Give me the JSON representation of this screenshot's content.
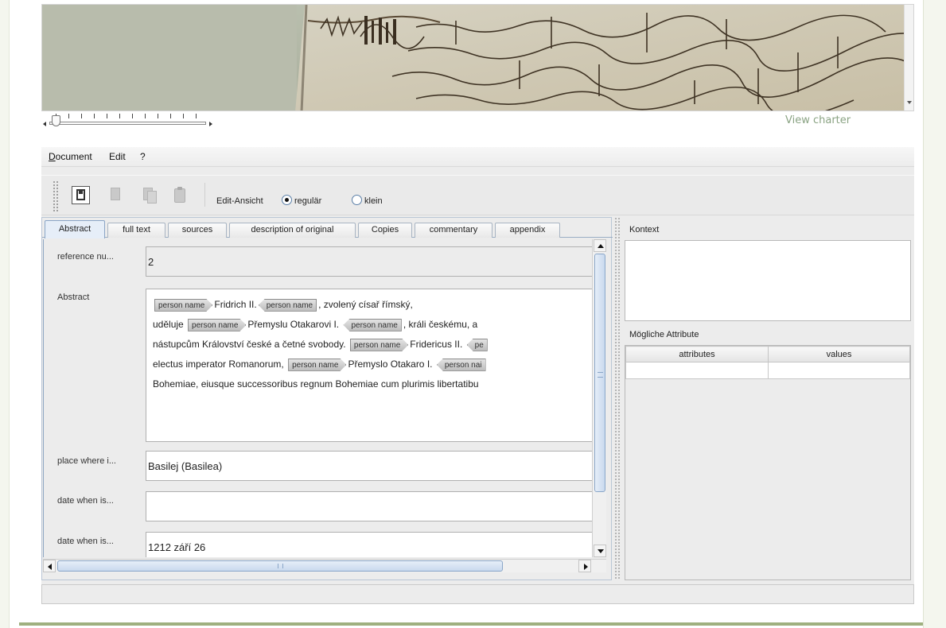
{
  "viewer": {
    "view_charter_link": "View charter"
  },
  "menu": {
    "document_mnemonic": "D",
    "document_rest": "ocument",
    "edit": "Edit",
    "help": "?"
  },
  "toolbar": {
    "edit_view_label": "Edit-Ansicht",
    "radio_regular": "regulär",
    "radio_small": "klein",
    "selected_view": "regulär"
  },
  "tabs": [
    {
      "label": "Abstract",
      "active": true
    },
    {
      "label": "full text"
    },
    {
      "label": "sources"
    },
    {
      "label": "description of original"
    },
    {
      "label": "Copies"
    },
    {
      "label": "commentary"
    },
    {
      "label": "appendix"
    }
  ],
  "form": {
    "reference_label": "reference nu...",
    "reference_value": "2",
    "abstract_label": "Abstract",
    "place_label": "place where i...",
    "place_value": "Basilej (Basilea)",
    "date1_label": "date when is...",
    "date1_value": "",
    "date2_label": "date when is...",
    "date2_value": "1212 září 26"
  },
  "abstract": {
    "tag_label": "person name",
    "line1": {
      "t1": "Fridrich II.",
      "t2": ", zvolený císař římský,"
    },
    "line2": {
      "t1": "uděluje",
      "t2": "Přemyslu Otakarovi I.",
      "t3": ", králi českému, a"
    },
    "line3": {
      "t1": "nástupcům Království české a četné svobody.",
      "t2": "Fridericus II.",
      "tag_clip": "pe"
    },
    "line4": {
      "t1": "electus imperator Romanorum,",
      "t2": "Přemyslo Otakaro I.",
      "tag_clip": "person nai"
    },
    "line5": {
      "t1": "Bohemiae, eiusque successoribus regnum Bohemiae cum plurimis libertatibu"
    }
  },
  "right_panel": {
    "context_label": "Kontext",
    "attributes_label": "Mögliche Attribute",
    "col_attributes": "attributes",
    "col_values": "values"
  },
  "colors": {
    "link_green": "#8aa383",
    "selection_blue": "#e6eef8",
    "bottom_bar": "#9fb07f"
  }
}
